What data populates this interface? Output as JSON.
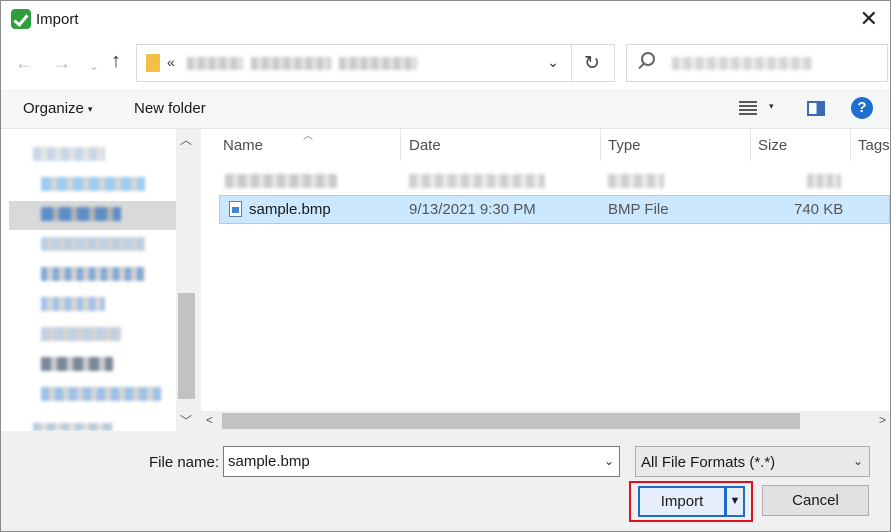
{
  "window": {
    "title": "Import",
    "close_glyph": "✕"
  },
  "nav": {
    "back": "←",
    "forward": "→",
    "recent": "⌄",
    "up": "↑"
  },
  "address": {
    "overflow": "«",
    "dropdown": "⌄",
    "refresh": "↻"
  },
  "toolbar": {
    "organize_label": "Organize",
    "organize_caret": "▾",
    "new_folder_label": "New folder",
    "view_caret": "▾",
    "help_label": "?"
  },
  "columns": {
    "name": "Name",
    "date": "Date",
    "type": "Type",
    "size": "Size",
    "tags": "Tags",
    "sort_glyph": "︿"
  },
  "files": [
    {
      "name": "sample.bmp",
      "date": "9/13/2021 9:30 PM",
      "type": "BMP File",
      "size": "740 KB"
    }
  ],
  "scroll": {
    "up": "︿",
    "down": "﹀",
    "left": "<",
    "right": ">"
  },
  "footer": {
    "file_name_label": "File name:",
    "file_name_value": "sample.bmp",
    "file_name_dropdown": "⌄",
    "file_type_value": "All File Formats (*.*)",
    "file_type_dropdown": "⌄",
    "import_label": "Import",
    "import_split": "▼",
    "cancel_label": "Cancel"
  },
  "colors": {
    "selection_bg": "#cce8ff",
    "selection_border": "#99d1ff",
    "highlight_box": "#e01020",
    "default_button_border": "#1e6ec8"
  },
  "icons": [
    "app-icon",
    "close-icon",
    "back-icon",
    "forward-icon",
    "up-icon",
    "folder-icon",
    "refresh-icon",
    "search-icon",
    "view-icon",
    "preview-pane-icon",
    "help-icon",
    "bmp-file-icon"
  ]
}
